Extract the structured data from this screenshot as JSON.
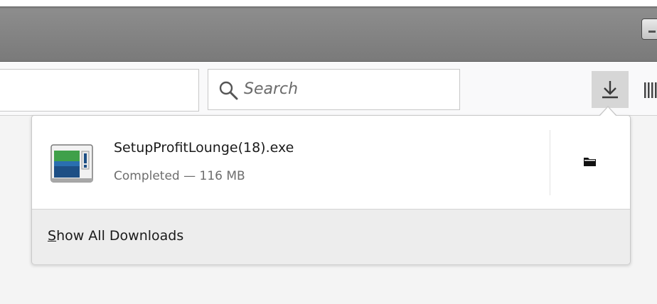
{
  "window": {
    "minimize_title": "Minimize"
  },
  "toolbar": {
    "urlbar_value": "",
    "search_placeholder": "Search",
    "icons": [
      "search-icon",
      "download-arrow-icon",
      "library-icon"
    ]
  },
  "downloads_panel": {
    "items": [
      {
        "filename": "SetupProfitLounge(18).exe",
        "status": "Completed — 116 MB",
        "icon": "exe-file-icon",
        "action_icon": "folder-icon"
      }
    ],
    "footer": {
      "accesskey": "S",
      "label_rest": "how All Downloads"
    }
  }
}
